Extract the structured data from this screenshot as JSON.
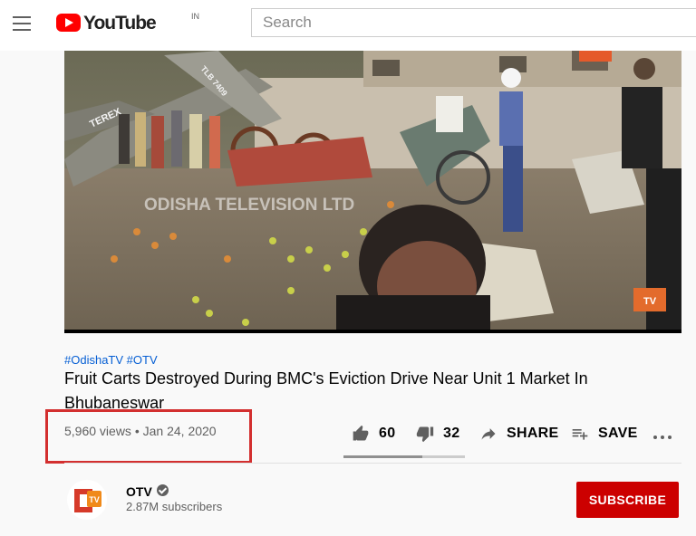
{
  "masthead": {
    "logo_text": "YouTube",
    "region": "IN",
    "search_placeholder": "Search"
  },
  "video": {
    "watermark": "ODISHA TELEVISION LTD",
    "vehicle_text": "TEREX",
    "plate_text": "TLB 7409"
  },
  "info": {
    "hashtags": [
      "#OdishaTV",
      "#OTV"
    ],
    "title": "Fruit Carts Destroyed During BMC's Eviction Drive Near Unit 1 Market In Bhubaneswar",
    "views": "5,960 views",
    "separator": "•",
    "date": "Jan 24, 2020"
  },
  "actions": {
    "like_count": "60",
    "dislike_count": "32",
    "share_label": "SHARE",
    "save_label": "SAVE",
    "like_ratio": 0.65
  },
  "channel": {
    "name": "OTV",
    "subscribers": "2.87M subscribers",
    "subscribe_label": "SUBSCRIBE"
  },
  "colors": {
    "brand_red": "#ff0000",
    "subscribe_red": "#cc0000",
    "link_blue": "#065fd4",
    "highlight_red": "#d32f2f"
  },
  "icons": [
    "menu-icon",
    "youtube-logo",
    "like-icon",
    "dislike-icon",
    "share-icon",
    "save-icon",
    "more-icon",
    "verified-icon"
  ]
}
